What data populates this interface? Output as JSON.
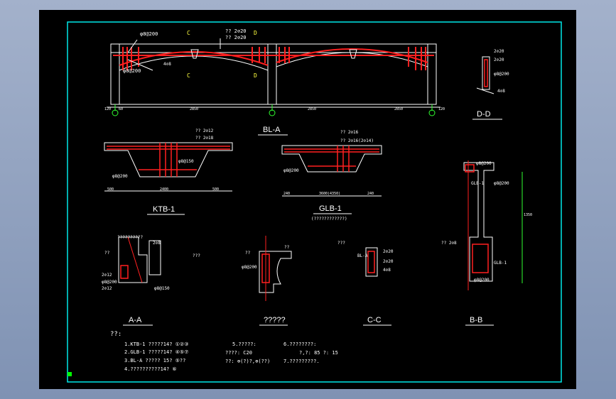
{
  "bl_a": {
    "title": "BL-A",
    "top_bar": "φ8@200",
    "top_bars": [
      "?? 2⊘20",
      "?? 2⊘20"
    ],
    "stirrup": "φ8@200",
    "bottom_bar": "4⊘8",
    "section_marks": [
      "C",
      "D",
      "C",
      "D"
    ],
    "dims": [
      "120",
      "60",
      "2850",
      "2850",
      "2850",
      "120"
    ],
    "axes": [
      "⑥",
      "⑦",
      "⑧"
    ]
  },
  "dd": {
    "title": "D-D",
    "labels": [
      "2⊘20",
      "2⊘20",
      "φ8@200",
      "4⊘8"
    ]
  },
  "ktb": {
    "title": "KTB-1",
    "labels": [
      "?? 2⊘12",
      "?? 2⊘18",
      "φ8@150",
      "φ8@200"
    ],
    "dims": [
      "500",
      "2400",
      "500"
    ]
  },
  "glb": {
    "title": "GLB-1",
    "subtitle": "(????????????)",
    "labels": [
      "?? 2⊘16",
      "?? 2⊘16(2⊘14)",
      "φ8@200"
    ],
    "dims": [
      "240",
      "3600(4350)",
      "240"
    ]
  },
  "aa": {
    "title": "A-A",
    "labels": [
      "??????????",
      "2⊘8",
      "2⊘12",
      "φ8@200",
      "2⊘12",
      "φ8@150",
      "??",
      "???"
    ]
  },
  "unknown": {
    "title": "?????",
    "labels": [
      "φ8@200",
      "??",
      "??"
    ]
  },
  "cc": {
    "title": "C-C",
    "labels": [
      "BL-A",
      "2⊘20",
      "2⊘20",
      "4⊘8",
      "???"
    ]
  },
  "bb": {
    "title": "B-B",
    "labels": [
      "φ8@200",
      "GLB-1",
      "φ8@200",
      "?? 2⊘8",
      "GLB-1",
      "φ8@200",
      "1350"
    ]
  },
  "notes": {
    "heading": "??:",
    "lines": [
      "1.KTB-1 ?????14?  ①②③",
      "2.GLB-1 ?????14?  ④⑤⑦",
      "3.BL-A ?????  15?  ⑤??",
      "4.??????????14?  ⑥"
    ],
    "col2": [
      "5.?????:",
      "????:  C20",
      "??:   ⊕(?)?,⊕(??)"
    ],
    "col3": [
      "6.????????:",
      "?,?: 85  ?: 15",
      "7.?????????."
    ]
  }
}
